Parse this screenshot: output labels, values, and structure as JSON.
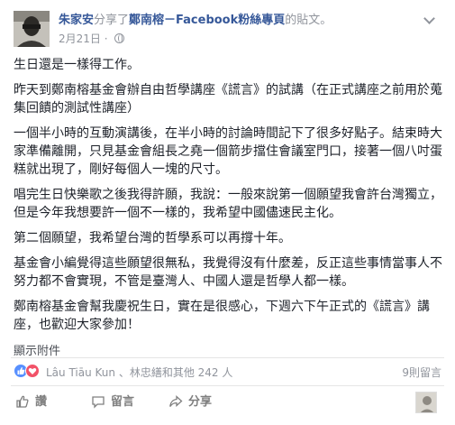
{
  "header": {
    "author_name": "朱家安",
    "shared_text": "分享了",
    "page_name": "鄭南榕－Facebook粉絲專頁",
    "post_word": "的貼文。",
    "date": "2月21日",
    "separator": "·"
  },
  "body": {
    "paragraphs": [
      "生日還是一樣得工作。",
      "昨天到鄭南榕基金會辦自由哲學講座《謊言》的試講（在正式講座之前用於蒐集回饋的測試性講座）",
      "一個半小時的互動演講後，在半小時的討論時間記下了很多好點子。結束時大家準備離開，只見基金會組長之堯一個箭步擋住會議室門口，接著一個八吋蛋糕就出現了，剛好每個人一塊的尺寸。",
      "唱完生日快樂歌之後我得許願，我說：一般來說第一個願望我會許台灣獨立，但是今年我想要許一個不一樣的，我希望中國儘速民主化。",
      "第二個願望，我希望台灣的哲學系可以再撐十年。",
      "基金會小編覺得這些願望很無私，我覺得沒有什麼差，反正這些事情當事人不努力都不會實現，不管是臺灣人、中國人還是哲學人都一樣。",
      "鄭南榕基金會幫我慶祝生日，實在是很感心，下週六下午正式的《謊言》講座，也歡迎大家參加！"
    ],
    "see_more": "顯示附件"
  },
  "reactions": {
    "summary": "Lâu Tiāu Kun 、林忠繕和其他 242 人",
    "comment_count": "9則留言"
  },
  "actions": {
    "like": "讚",
    "comment": "留言",
    "share": "分享"
  },
  "colors": {
    "link": "#365899",
    "muted": "#90949c",
    "text": "#1d2129",
    "like_blue": "#5890ff",
    "heart_red": "#f25268"
  }
}
